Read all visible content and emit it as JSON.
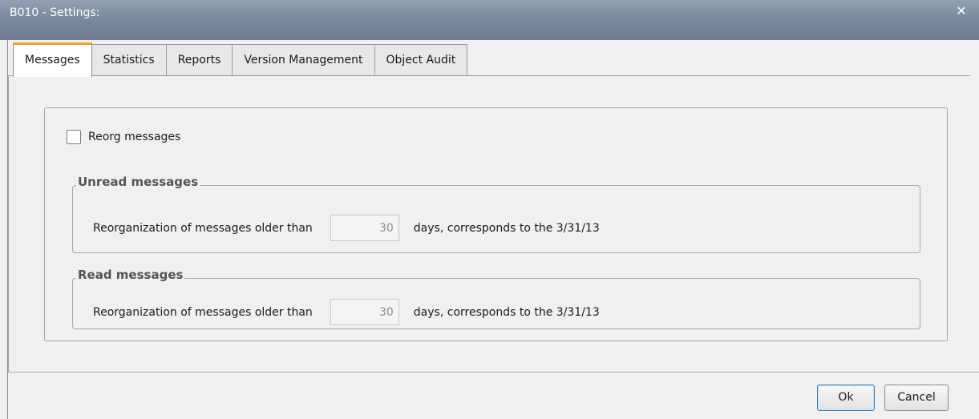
{
  "window": {
    "title": "B010 - Settings:",
    "close_icon": "close-icon"
  },
  "tabs": [
    {
      "label": "Messages",
      "active": true
    },
    {
      "label": "Statistics",
      "active": false
    },
    {
      "label": "Reports",
      "active": false
    },
    {
      "label": "Version Management",
      "active": false
    },
    {
      "label": "Object Audit",
      "active": false
    }
  ],
  "messages_tab": {
    "reorg_checkbox": {
      "label": "Reorg messages",
      "checked": false
    },
    "unread": {
      "legend": "Unread messages",
      "prefix": "Reorganization of messages older than",
      "days_value": "30",
      "suffix": "days, corresponds to the 3/31/13"
    },
    "read": {
      "legend": "Read messages",
      "prefix": "Reorganization of messages older than",
      "days_value": "30",
      "suffix": "days, corresponds to the 3/31/13"
    }
  },
  "buttons": {
    "ok": "Ok",
    "cancel": "Cancel"
  },
  "colors": {
    "active_tab_accent": "#f0a030",
    "titlebar": "#7b8a9e",
    "ok_focus_border": "#3c7fb1"
  }
}
